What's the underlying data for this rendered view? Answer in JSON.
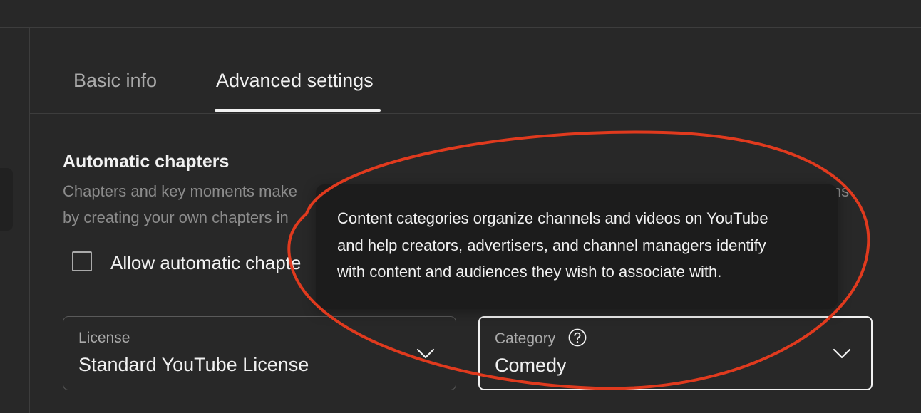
{
  "tabs": {
    "basic_info": "Basic info",
    "advanced_settings": "Advanced settings"
  },
  "chapters": {
    "title": "Automatic chapters",
    "description_line_1": "Chapters and key moments make",
    "description_line_2": "by creating your own chapters in",
    "description_tail": "ns",
    "checkbox_label": "Allow automatic chapte",
    "checkbox_checked": false
  },
  "tooltip": {
    "line_1": "Content categories organize channels and videos on YouTube",
    "line_2": "and help creators, advertisers, and channel managers identify",
    "line_3": "with content and audiences they wish to associate with."
  },
  "license": {
    "label": "License",
    "value": "Standard YouTube License",
    "icon": "chevron-down-icon"
  },
  "category": {
    "label": "Category",
    "value": "Comedy",
    "help_icon": "help-circle-icon",
    "icon": "chevron-down-icon"
  },
  "colors": {
    "background": "#282828",
    "text_primary": "#f1f1f1",
    "text_secondary": "#aaaaaa",
    "tooltip_background": "#1c1c1c",
    "annotation_red": "#e03a1e"
  }
}
